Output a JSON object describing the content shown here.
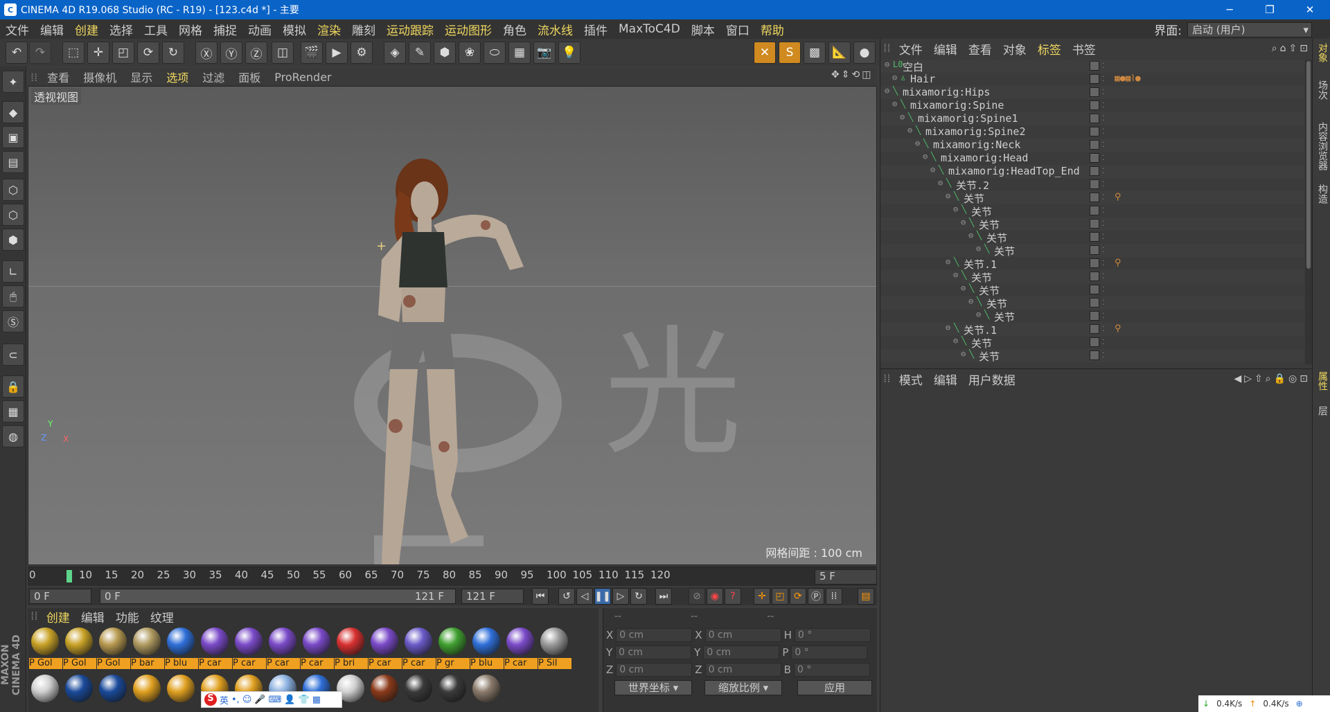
{
  "titlebar": {
    "title": "CINEMA 4D R19.068 Studio (RC - R19) - [123.c4d *] - 主要",
    "min": "─",
    "max": "❐",
    "close": "✕"
  },
  "menubar": {
    "items": [
      {
        "label": "文件",
        "hl": false
      },
      {
        "label": "编辑",
        "hl": false
      },
      {
        "label": "创建",
        "hl": true
      },
      {
        "label": "选择",
        "hl": false
      },
      {
        "label": "工具",
        "hl": false
      },
      {
        "label": "网格",
        "hl": false
      },
      {
        "label": "捕捉",
        "hl": false
      },
      {
        "label": "动画",
        "hl": false
      },
      {
        "label": "模拟",
        "hl": false
      },
      {
        "label": "渲染",
        "hl": true
      },
      {
        "label": "雕刻",
        "hl": false
      },
      {
        "label": "运动跟踪",
        "hl": true
      },
      {
        "label": "运动图形",
        "hl": true
      },
      {
        "label": "角色",
        "hl": false
      },
      {
        "label": "流水线",
        "hl": true
      },
      {
        "label": "插件",
        "hl": false
      },
      {
        "label": "MaxToC4D",
        "hl": false
      },
      {
        "label": "脚本",
        "hl": false
      },
      {
        "label": "窗口",
        "hl": false
      },
      {
        "label": "帮助",
        "hl": true
      }
    ],
    "layout_label": "界面:",
    "layout_value": "启动 (用户)"
  },
  "viewport": {
    "menu": [
      "查看",
      "摄像机",
      "显示",
      "选项",
      "过滤",
      "面板",
      "ProRender"
    ],
    "menu_hl_index": 3,
    "label": "透视视图",
    "grid_info": "网格间距 : 100 cm",
    "watermark": "光厂",
    "axis_y": "Y",
    "axis_z": "Z",
    "axis_x": "X"
  },
  "timeline": {
    "ticks": [
      "0",
      "10",
      "15",
      "20",
      "25",
      "30",
      "35",
      "40",
      "45",
      "50",
      "55",
      "60",
      "65",
      "70",
      "75",
      "80",
      "85",
      "90",
      "95",
      "100",
      "105",
      "110",
      "115",
      "120"
    ],
    "current": "5 F"
  },
  "transport": {
    "start": "0 F",
    "range_start": "0 F",
    "range_end": "121 F",
    "end": "121 F"
  },
  "material_panel": {
    "menu": [
      "创建",
      "编辑",
      "功能",
      "纹理"
    ],
    "materials": [
      {
        "label": "P Gol",
        "color": "#c9a227"
      },
      {
        "label": "P Gol",
        "color": "#c9a227"
      },
      {
        "label": "P Gol",
        "color": "#b89a50"
      },
      {
        "label": "P bar",
        "color": "#b09a60"
      },
      {
        "label": "P blu",
        "color": "#2f6fd8"
      },
      {
        "label": "P car",
        "color": "#7a4ac8"
      },
      {
        "label": "P car",
        "color": "#7a4ac8"
      },
      {
        "label": "P car",
        "color": "#7a4ac8"
      },
      {
        "label": "P car",
        "color": "#7a4ac8"
      },
      {
        "label": "P bri",
        "color": "#d83030"
      },
      {
        "label": "P car",
        "color": "#7a4ac8"
      },
      {
        "label": "P car",
        "color": "#6a5ac8"
      },
      {
        "label": "P gr",
        "color": "#40a030"
      },
      {
        "label": "P blu",
        "color": "#2f6fd8"
      },
      {
        "label": "P car",
        "color": "#7a4ac8"
      },
      {
        "label": "P Sil",
        "color": "#9a9a9a"
      }
    ],
    "row2_colors": [
      "#cfcfcf",
      "#1a4a9a",
      "#1a4a9a",
      "#e0a020",
      "#e0a020",
      "#e0a020",
      "#e0a020",
      "#8ab0e0",
      "#2f6fd8",
      "#d0d0d0",
      "#8a3a1a",
      "#3a3a3a",
      "#3a3a3a",
      "#8a7a6a"
    ]
  },
  "coords": {
    "headers": [
      "--",
      "--",
      "--"
    ],
    "rows": [
      {
        "a": "X",
        "av": "0 cm",
        "b": "X",
        "bv": "0 cm",
        "c": "H",
        "cv": "0 °"
      },
      {
        "a": "Y",
        "av": "0 cm",
        "b": "Y",
        "bv": "0 cm",
        "c": "P",
        "cv": "0 °"
      },
      {
        "a": "Z",
        "av": "0 cm",
        "b": "Z",
        "bv": "0 cm",
        "c": "B",
        "cv": "0 °"
      }
    ],
    "world": "世界坐标",
    "scale": "缩放比例",
    "apply": "应用"
  },
  "object_panel": {
    "menu": [
      "文件",
      "编辑",
      "查看",
      "对象",
      "标签",
      "书签"
    ],
    "menu_hl_index": 4,
    "rows": [
      {
        "name": "空白",
        "indent": 0,
        "icon": "L0",
        "tags": ""
      },
      {
        "name": "Hair",
        "indent": 1,
        "icon": "♙",
        "tags": "▦●▦⌇●"
      },
      {
        "name": "mixamorig:Hips",
        "indent": 0,
        "icon": "╲",
        "tags": ""
      },
      {
        "name": "mixamorig:Spine",
        "indent": 1,
        "icon": "╲",
        "tags": ""
      },
      {
        "name": "mixamorig:Spine1",
        "indent": 2,
        "icon": "╲",
        "tags": ""
      },
      {
        "name": "mixamorig:Spine2",
        "indent": 3,
        "icon": "╲",
        "tags": ""
      },
      {
        "name": "mixamorig:Neck",
        "indent": 4,
        "icon": "╲",
        "tags": ""
      },
      {
        "name": "mixamorig:Head",
        "indent": 5,
        "icon": "╲",
        "tags": ""
      },
      {
        "name": "mixamorig:HeadTop_End",
        "indent": 6,
        "icon": "╲",
        "tags": ""
      },
      {
        "name": "关节.2",
        "indent": 7,
        "icon": "╲",
        "tags": ""
      },
      {
        "name": "关节",
        "indent": 8,
        "icon": "╲",
        "tags": "⚲"
      },
      {
        "name": "关节",
        "indent": 9,
        "icon": "╲",
        "tags": ""
      },
      {
        "name": "关节",
        "indent": 10,
        "icon": "╲",
        "tags": ""
      },
      {
        "name": "关节",
        "indent": 11,
        "icon": "╲",
        "tags": ""
      },
      {
        "name": "关节",
        "indent": 12,
        "icon": "╲",
        "tags": ""
      },
      {
        "name": "关节.1",
        "indent": 8,
        "icon": "╲",
        "tags": "⚲"
      },
      {
        "name": "关节",
        "indent": 9,
        "icon": "╲",
        "tags": ""
      },
      {
        "name": "关节",
        "indent": 10,
        "icon": "╲",
        "tags": ""
      },
      {
        "name": "关节",
        "indent": 11,
        "icon": "╲",
        "tags": ""
      },
      {
        "name": "关节",
        "indent": 12,
        "icon": "╲",
        "tags": ""
      },
      {
        "name": "关节.1",
        "indent": 8,
        "icon": "╲",
        "tags": "⚲"
      },
      {
        "name": "关节",
        "indent": 9,
        "icon": "╲",
        "tags": ""
      },
      {
        "name": "关节",
        "indent": 10,
        "icon": "╲",
        "tags": ""
      }
    ]
  },
  "attr_panel": {
    "menu": [
      "模式",
      "编辑",
      "用户数据"
    ]
  },
  "side_tabs": [
    {
      "label": "对象",
      "hl": true
    },
    {
      "label": "场次",
      "hl": false
    },
    {
      "label": "内容浏览器",
      "hl": false
    },
    {
      "label": "构造",
      "hl": false
    },
    {
      "label": "属性",
      "hl": true
    },
    {
      "label": "层",
      "hl": false
    }
  ],
  "maxon": "MAXON CINEMA 4D",
  "status": {
    "down": "0.4K/s",
    "up": "0.4K/s"
  },
  "ime": {
    "logo": "S",
    "lang": "英"
  }
}
